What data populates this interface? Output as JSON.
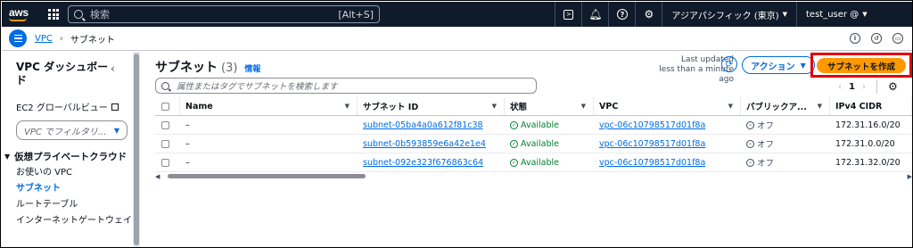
{
  "topnav": {
    "logo": "aws",
    "search_placeholder": "検索",
    "search_shortcut": "[Alt+S]",
    "region": "アジアパシフィック (東京)",
    "user": "test_user @"
  },
  "subbar": {
    "breadcrumb": [
      "VPC",
      "サブネット"
    ]
  },
  "sidebar": {
    "title": "VPC ダッシュボード",
    "ec2_link": "EC2 グローバルビュー",
    "filter_placeholder": "VPC でフィルタリ...",
    "section": "仮想プライベートクラウド",
    "items": [
      "お使いの VPC",
      "サブネット",
      "ルートテーブル",
      "インターネットゲートウェイ"
    ]
  },
  "main": {
    "title": "サブネット",
    "count": "(3)",
    "info": "情報",
    "updated_line1": "Last updated",
    "updated_line2": "less than a minute ago",
    "actions_label": "アクション",
    "create_label": "サブネットを作成",
    "search_placeholder": "属性またはタグでサブネットを検索します",
    "page": "1",
    "columns": [
      "Name",
      "サブネット ID",
      "状態",
      "VPC",
      "パブリックア...",
      "IPv4 CIDR"
    ],
    "rows": [
      {
        "name": "–",
        "subnet_id": "subnet-05ba4a0a612f81c38",
        "state": "Available",
        "vpc": "vpc-06c10798517d01f8a",
        "public": "オフ",
        "cidr": "172.31.16.0/20"
      },
      {
        "name": "–",
        "subnet_id": "subnet-0b593859e6a42e1e4",
        "state": "Available",
        "vpc": "vpc-06c10798517d01f8a",
        "public": "オフ",
        "cidr": "172.31.0.0/20"
      },
      {
        "name": "–",
        "subnet_id": "subnet-092e323f676863c64",
        "state": "Available",
        "vpc": "vpc-06c10798517d01f8a",
        "public": "オフ",
        "cidr": "172.31.32.0/20"
      }
    ]
  },
  "colors": {
    "nav_bg": "#0f1b2a",
    "accent": "#006ce0",
    "primary": "#ff9900",
    "highlight": "#e0000f",
    "success": "#00802f"
  }
}
